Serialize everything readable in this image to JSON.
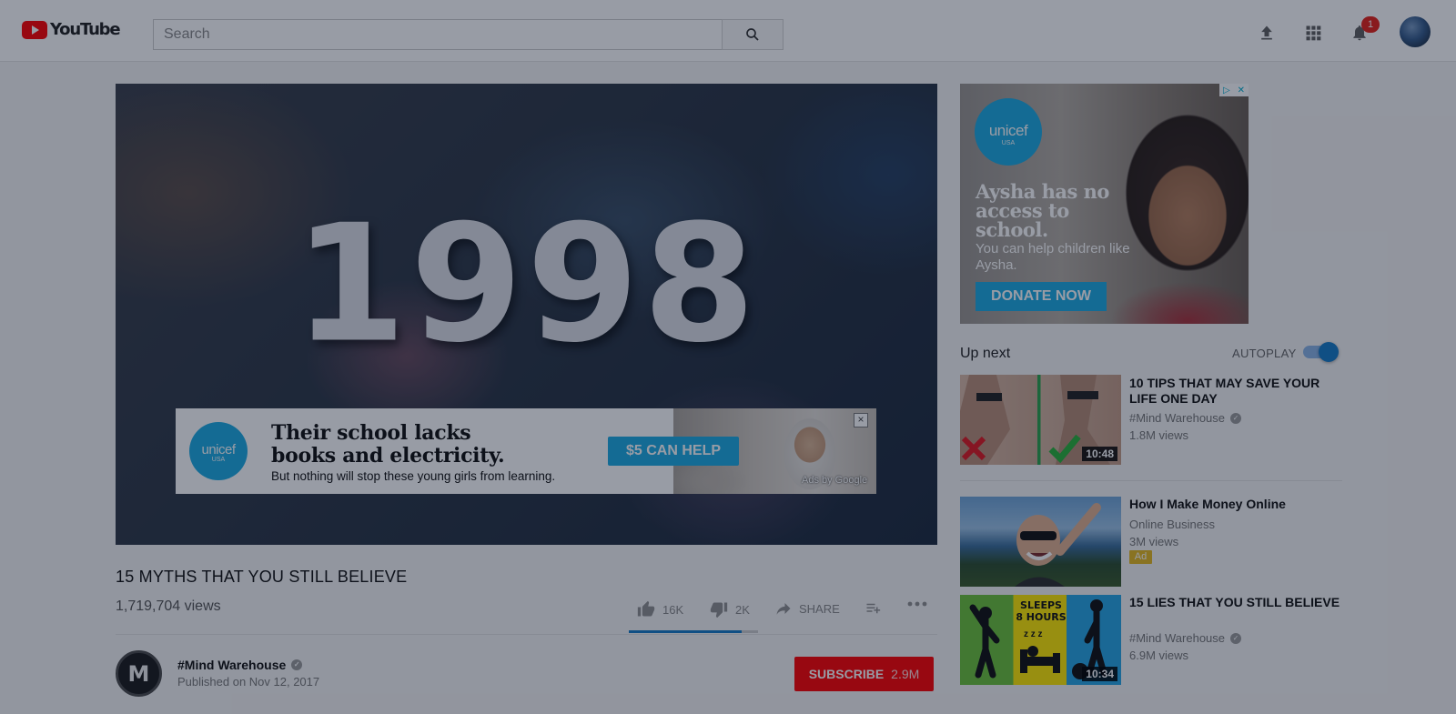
{
  "header": {
    "logo_text": "YouTube",
    "search_placeholder": "Search",
    "notification_count": "1"
  },
  "player": {
    "title_card": "1998",
    "overlay_ad": {
      "logo_name": "unicef",
      "logo_sub": "USA",
      "headline_line1": "Their school lacks",
      "headline_line2": "books and electricity.",
      "subtext": "But nothing will stop these young girls from learning.",
      "cta": "$5 CAN HELP",
      "close": "×",
      "attribution": "Ads by Google"
    }
  },
  "video": {
    "title": "15 MYTHS THAT YOU STILL BELIEVE",
    "views": "1,719,704 views",
    "likes": "16K",
    "dislikes": "2K",
    "share_label": "SHARE",
    "like_ratio": 0.87,
    "channel": {
      "avatar_letter": "M",
      "name": "#Mind Warehouse",
      "published": "Published on Nov 12, 2017"
    },
    "subscribe": {
      "label": "SUBSCRIBE",
      "count": "2.9M"
    }
  },
  "sidebar": {
    "ad": {
      "logo_name": "unicef",
      "logo_sub": "USA",
      "headline": "Aysha has no access to school.",
      "subtext": "You can help children like Aysha.",
      "cta": "DONATE NOW"
    },
    "upnext_label": "Up next",
    "autoplay_label": "AUTOPLAY",
    "autoplay_on": true,
    "recommendations": [
      {
        "title": "10 TIPS THAT MAY SAVE YOUR LIFE ONE DAY",
        "channel": "#Mind Warehouse",
        "verified": true,
        "views": "1.8M views",
        "duration": "10:48"
      },
      {
        "title": "How I Make Money Online",
        "channel": "Online Business",
        "verified": false,
        "views": "3M views",
        "badge": "Ad"
      },
      {
        "title": "15 LIES THAT YOU STILL BELIEVE",
        "channel": "#Mind Warehouse",
        "verified": true,
        "views": "6.9M views",
        "duration": "10:34",
        "thumb_text_line1": "SLEEPS",
        "thumb_text_line2": "8 HOURS",
        "thumb_zzz": "z z z"
      }
    ]
  },
  "colors": {
    "brand_red": "#ff0000",
    "unicef_blue": "#1cabe2",
    "accent_blue": "#167ac6",
    "ad_badge": "#e6b91e"
  },
  "icons": [
    "youtube-logo-icon",
    "search-icon",
    "upload-icon",
    "apps-grid-icon",
    "bell-icon",
    "thumbs-up-icon",
    "thumbs-down-icon",
    "share-icon",
    "add-to-playlist-icon",
    "more-icon",
    "verified-icon"
  ]
}
